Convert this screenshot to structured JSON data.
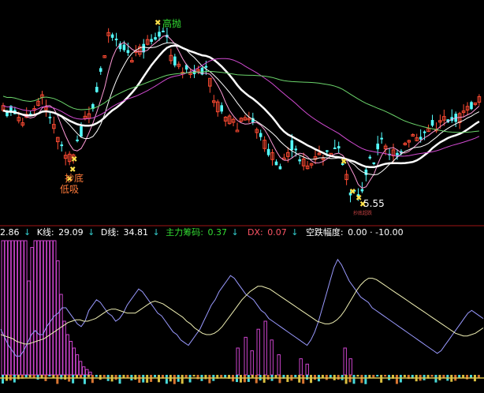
{
  "price_panel": {
    "high_label": "高抛",
    "low_labels": [
      "抄底",
      "低吸"
    ],
    "low_price": "5.55",
    "small_tag": "抄底超跌"
  },
  "indicator_bar": {
    "left_partial": "2.86",
    "k_label": "K线:",
    "k_value": "29.09",
    "d_label": "D线:",
    "d_value": "34.81",
    "main_label": "主力筹码:",
    "main_value": "0.37",
    "dx_label": "DX:",
    "dx_value": "0.07",
    "range_label": "空跌幅度:",
    "range_value": "0.00 · -10.00",
    "arrow": "↓"
  },
  "colors": {
    "bg": "#000000",
    "up": "#ff4b33",
    "down": "#54ffff",
    "ma_white": "#ffffff",
    "ma_magenta": "#d24bd2",
    "ma_green": "#6bd46b",
    "ma_pink": "#ff9ad8",
    "divider": "#a01414",
    "k_line": "#9a9aff",
    "d_line": "#f0f0b4",
    "hist": "#cc44cc",
    "label_white": "#ffffff",
    "label_green": "#33dd33",
    "label_cyan": "#33cccc",
    "label_yellow": "#ffe14a"
  },
  "chart_data": [
    {
      "type": "candlestick",
      "x": [
        "",
        "",
        "",
        "",
        "",
        "",
        "",
        "",
        "",
        "",
        "",
        "",
        "",
        "",
        "",
        "",
        "",
        "",
        "",
        "",
        "",
        "",
        "",
        "",
        "",
        "",
        "",
        "",
        "",
        "",
        "",
        "",
        "",
        "",
        "",
        "",
        "",
        "",
        "",
        "",
        "",
        "",
        "",
        "",
        "",
        "",
        "",
        "",
        "",
        "",
        "",
        "",
        "",
        "",
        "",
        "",
        "",
        "",
        "",
        "",
        "",
        "",
        "",
        "",
        "",
        "",
        "",
        "",
        "",
        "",
        "",
        "",
        "",
        "",
        "",
        "",
        "",
        "",
        "",
        "",
        "",
        "",
        "",
        "",
        "",
        "",
        "",
        "",
        "",
        "",
        "",
        "",
        "",
        "",
        "",
        "",
        "",
        "",
        "",
        "",
        "",
        "",
        "",
        "",
        "",
        "",
        "",
        "",
        "",
        "",
        "",
        "",
        "",
        "",
        "",
        "",
        "",
        "",
        "",
        "",
        "",
        "",
        ""
      ],
      "low_point": 5.55
    },
    {
      "type": "line",
      "series": [
        {
          "values": [
            34,
            28,
            22,
            18,
            14,
            14,
            18,
            24,
            30,
            33,
            30,
            30,
            36,
            40,
            44,
            46,
            50,
            50,
            46,
            42,
            38,
            36,
            40,
            48,
            52,
            56,
            54,
            50,
            46,
            44,
            40,
            42,
            46,
            52,
            56,
            60,
            64,
            62,
            58,
            54,
            50,
            46,
            44,
            40,
            36,
            32,
            30,
            26,
            24,
            22,
            26,
            30,
            34,
            40,
            46,
            52,
            56,
            62,
            66,
            70,
            74,
            72,
            68,
            64,
            60,
            58,
            56,
            52,
            48,
            46,
            42,
            40,
            38,
            36,
            34,
            32,
            30,
            28,
            26,
            24,
            22,
            26,
            32,
            40,
            50,
            60,
            70,
            80,
            86,
            82,
            76,
            70,
            66,
            62,
            58,
            56,
            54,
            50,
            48,
            46,
            44,
            42,
            40,
            38,
            36,
            34,
            32,
            30,
            28,
            26,
            24,
            22,
            20,
            18,
            16,
            18,
            22,
            26,
            30,
            34,
            38,
            42,
            46,
            48,
            46,
            44,
            42
          ]
        },
        {
          "values": [
            30,
            29,
            28,
            27,
            25,
            24,
            23,
            23,
            24,
            25,
            26,
            27,
            29,
            31,
            33,
            35,
            37,
            39,
            40,
            41,
            41,
            40,
            40,
            41,
            42,
            44,
            46,
            48,
            49,
            49,
            48,
            47,
            46,
            46,
            46,
            48,
            50,
            52,
            54,
            55,
            54,
            53,
            51,
            49,
            47,
            45,
            43,
            40,
            38,
            35,
            33,
            31,
            30,
            30,
            31,
            33,
            36,
            40,
            44,
            48,
            52,
            56,
            59,
            62,
            64,
            66,
            66,
            65,
            64,
            62,
            60,
            58,
            56,
            54,
            52,
            50,
            48,
            46,
            44,
            42,
            40,
            39,
            38,
            38,
            39,
            41,
            44,
            48,
            53,
            58,
            63,
            67,
            70,
            72,
            72,
            71,
            69,
            67,
            65,
            63,
            61,
            59,
            57,
            55,
            53,
            51,
            49,
            47,
            45,
            43,
            41,
            39,
            37,
            35,
            33,
            31,
            30,
            29,
            29,
            30,
            31,
            33,
            35
          ]
        }
      ],
      "yrange": [
        0,
        100
      ]
    }
  ]
}
